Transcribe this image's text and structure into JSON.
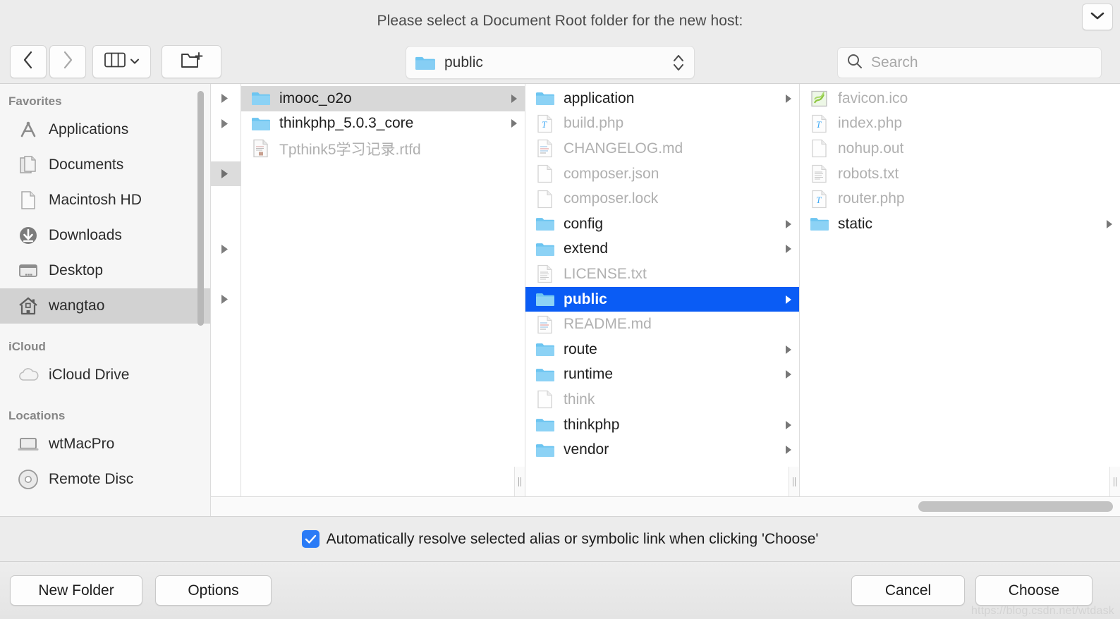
{
  "dialog": {
    "title": "Please select a Document Root folder for the new host:",
    "collapse_icon": "chevron-down-icon"
  },
  "toolbar": {
    "back_icon": "chevron-left-icon",
    "forward_icon": "chevron-right-icon",
    "view_icon": "column-view-icon",
    "view_dropdown_icon": "chevron-down-icon",
    "new_folder_icon": "new-folder-icon",
    "path_popup": {
      "label": "public",
      "icon": "folder-icon",
      "stepper_icon": "up-down-stepper-icon"
    },
    "search": {
      "placeholder": "Search",
      "value": "",
      "icon": "search-icon"
    }
  },
  "sidebar": {
    "sections": [
      {
        "header": "Favorites",
        "items": [
          {
            "label": "Applications",
            "icon": "applications-icon",
            "selected": false
          },
          {
            "label": "Documents",
            "icon": "documents-icon",
            "selected": false
          },
          {
            "label": "Macintosh HD",
            "icon": "document-icon",
            "selected": false
          },
          {
            "label": "Downloads",
            "icon": "downloads-icon",
            "selected": false
          },
          {
            "label": "Desktop",
            "icon": "desktop-icon",
            "selected": false
          },
          {
            "label": "wangtao",
            "icon": "home-icon",
            "selected": true
          }
        ]
      },
      {
        "header": "iCloud",
        "items": [
          {
            "label": "iCloud Drive",
            "icon": "cloud-icon",
            "selected": false
          }
        ]
      },
      {
        "header": "Locations",
        "items": [
          {
            "label": "wtMacPro",
            "icon": "laptop-icon",
            "selected": false
          },
          {
            "label": "Remote Disc",
            "icon": "disc-icon",
            "selected": false
          }
        ]
      }
    ]
  },
  "browser": {
    "partial_column": {
      "rows": [
        {
          "arrow": true,
          "highlighted": false
        },
        {
          "arrow": true,
          "highlighted": false
        },
        {
          "arrow": false,
          "highlighted": false
        },
        {
          "arrow": true,
          "highlighted": true
        },
        {
          "arrow": false,
          "highlighted": false
        },
        {
          "arrow": false,
          "highlighted": false
        },
        {
          "arrow": true,
          "highlighted": false
        },
        {
          "arrow": false,
          "highlighted": false
        },
        {
          "arrow": true,
          "highlighted": false
        }
      ]
    },
    "column1": {
      "items": [
        {
          "label": "imooc_o2o",
          "type": "folder",
          "arrow": true,
          "dim": false,
          "selection": "inactive"
        },
        {
          "label": "thinkphp_5.0.3_core",
          "type": "folder",
          "arrow": true,
          "dim": false,
          "selection": "none"
        },
        {
          "label": "Tpthink5学习记录.rtfd",
          "type": "rtfd",
          "arrow": false,
          "dim": true,
          "selection": "none"
        }
      ]
    },
    "column2": {
      "items": [
        {
          "label": "application",
          "type": "folder",
          "arrow": true,
          "dim": false,
          "selection": "none"
        },
        {
          "label": "build.php",
          "type": "php",
          "arrow": false,
          "dim": true,
          "selection": "none"
        },
        {
          "label": "CHANGELOG.md",
          "type": "md",
          "arrow": false,
          "dim": true,
          "selection": "none"
        },
        {
          "label": "composer.json",
          "type": "blank",
          "arrow": false,
          "dim": true,
          "selection": "none"
        },
        {
          "label": "composer.lock",
          "type": "blank",
          "arrow": false,
          "dim": true,
          "selection": "none"
        },
        {
          "label": "config",
          "type": "folder",
          "arrow": true,
          "dim": false,
          "selection": "none"
        },
        {
          "label": "extend",
          "type": "folder",
          "arrow": true,
          "dim": false,
          "selection": "none"
        },
        {
          "label": "LICENSE.txt",
          "type": "txt",
          "arrow": false,
          "dim": true,
          "selection": "none"
        },
        {
          "label": "public",
          "type": "folder",
          "arrow": true,
          "dim": false,
          "selection": "active"
        },
        {
          "label": "README.md",
          "type": "md",
          "arrow": false,
          "dim": true,
          "selection": "none"
        },
        {
          "label": "route",
          "type": "folder",
          "arrow": true,
          "dim": false,
          "selection": "none"
        },
        {
          "label": "runtime",
          "type": "folder",
          "arrow": true,
          "dim": false,
          "selection": "none"
        },
        {
          "label": "think",
          "type": "blank",
          "arrow": false,
          "dim": true,
          "selection": "none"
        },
        {
          "label": "thinkphp",
          "type": "folder",
          "arrow": true,
          "dim": false,
          "selection": "none"
        },
        {
          "label": "vendor",
          "type": "folder",
          "arrow": true,
          "dim": false,
          "selection": "none"
        }
      ]
    },
    "column3": {
      "items": [
        {
          "label": "favicon.ico",
          "type": "ico",
          "arrow": false,
          "dim": true,
          "selection": "none"
        },
        {
          "label": "index.php",
          "type": "php",
          "arrow": false,
          "dim": true,
          "selection": "none"
        },
        {
          "label": "nohup.out",
          "type": "blank",
          "arrow": false,
          "dim": true,
          "selection": "none"
        },
        {
          "label": "robots.txt",
          "type": "txt",
          "arrow": false,
          "dim": true,
          "selection": "none"
        },
        {
          "label": "router.php",
          "type": "php",
          "arrow": false,
          "dim": true,
          "selection": "none"
        },
        {
          "label": "static",
          "type": "folder",
          "arrow": true,
          "dim": false,
          "selection": "none"
        }
      ]
    }
  },
  "footer": {
    "alias_checkbox": {
      "checked": true,
      "label": "Automatically resolve selected alias or symbolic link when clicking 'Choose'"
    },
    "buttons": {
      "new_folder": "New Folder",
      "options": "Options",
      "cancel": "Cancel",
      "choose": "Choose"
    }
  },
  "watermark": "https://blog.csdn.net/wtdask",
  "colors": {
    "selection_active": "#0a5cf5",
    "selection_inactive": "#d8d8d8",
    "sidebar_selection": "#d2d2d2",
    "checkbox_blue": "#2a7bf6",
    "folder_blue": "#6dc5f1",
    "window_bg": "#ececec"
  }
}
